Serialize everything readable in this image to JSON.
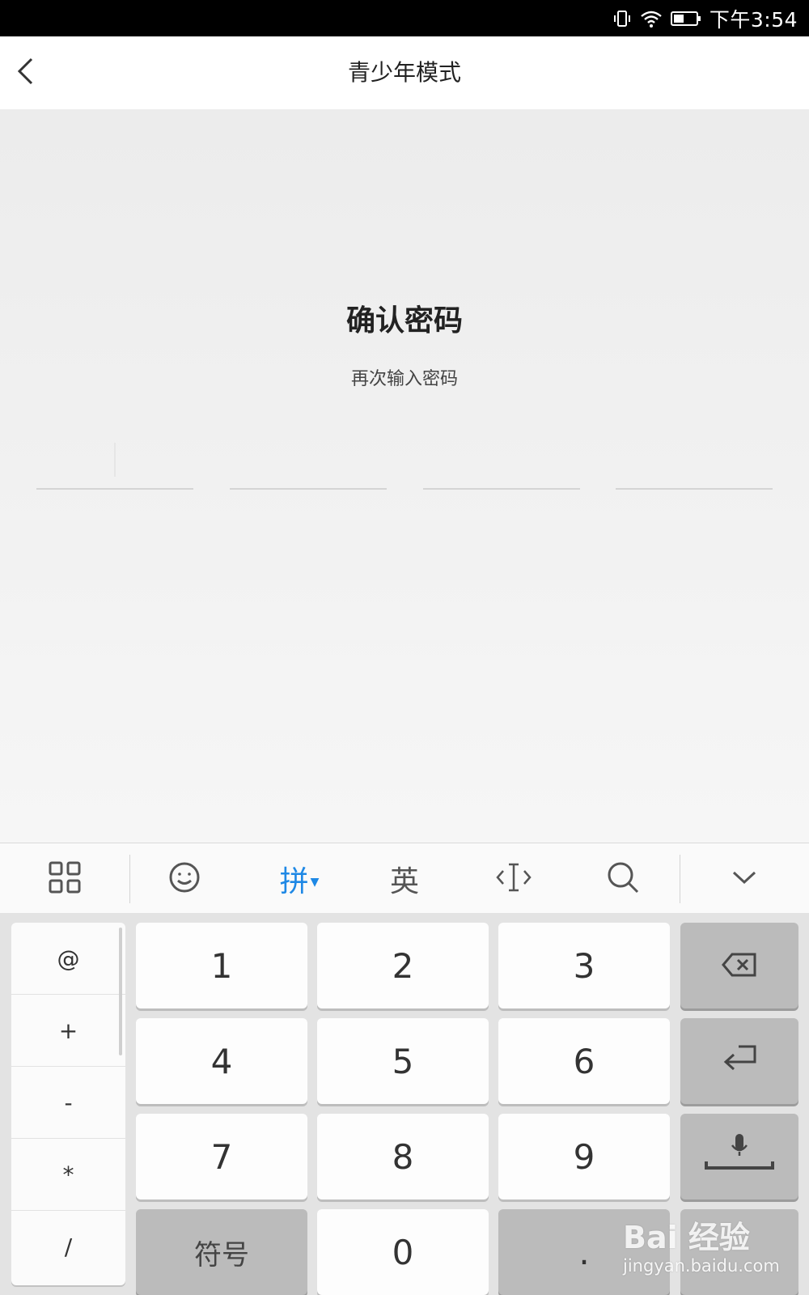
{
  "status_bar": {
    "time": "下午3:54",
    "icons": [
      "vibrate-icon",
      "wifi-icon",
      "battery-icon"
    ]
  },
  "header": {
    "back_icon": "chevron-left-icon",
    "title": "青少年模式"
  },
  "main": {
    "title": "确认密码",
    "subtitle": "再次输入密码",
    "pin_slots": 4
  },
  "keyboard_toolbar": {
    "items": [
      {
        "name": "apps-grid-icon"
      },
      {
        "name": "emoji-icon"
      },
      {
        "label": "拼",
        "active": true
      },
      {
        "label": "英"
      },
      {
        "name": "cursor-move-icon"
      },
      {
        "name": "search-icon"
      },
      {
        "name": "collapse-keyboard-icon"
      }
    ],
    "active_color": "#1e88e5"
  },
  "keyboard": {
    "symbols": [
      "@",
      "+",
      "-",
      "*",
      "/"
    ],
    "digits": [
      "1",
      "2",
      "3",
      "4",
      "5",
      "6",
      "7",
      "8",
      "9"
    ],
    "symbol_key": "符号",
    "zero": "0",
    "dot": "."
  },
  "watermark": {
    "main": "Bai 经验",
    "url": "jingyan.baidu.com"
  }
}
